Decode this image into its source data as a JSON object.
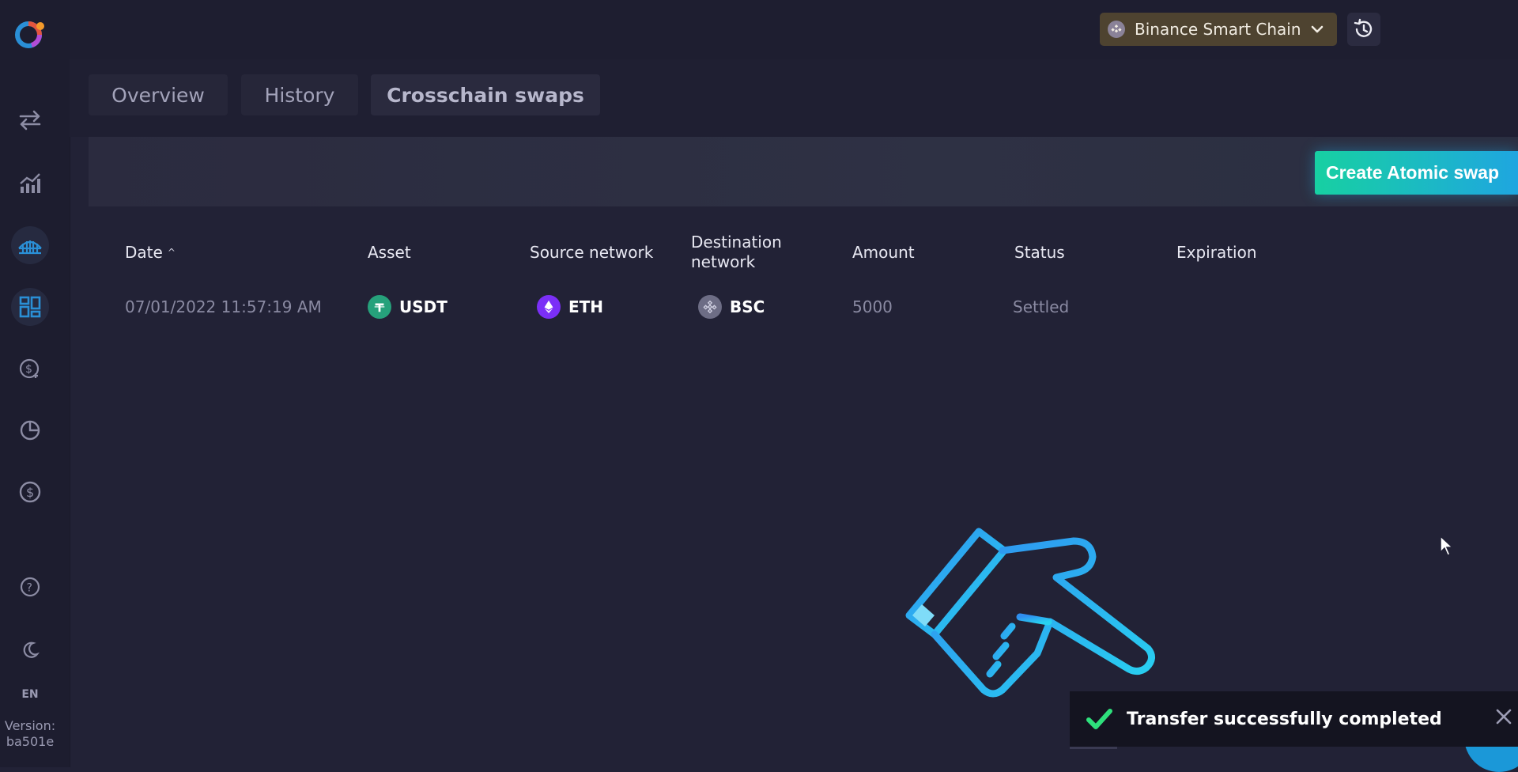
{
  "header": {
    "network": "Binance Smart Chain",
    "icons": {
      "network": "bnb-icon",
      "dropdown": "chevron-down-icon",
      "history": "history-clock-icon"
    }
  },
  "tabs": [
    {
      "label": "Overview",
      "active": false
    },
    {
      "label": "History",
      "active": false
    },
    {
      "label": "Crosschain swaps",
      "active": true
    }
  ],
  "actions": {
    "create_label": "Create Atomic swap"
  },
  "table": {
    "columns": [
      "Date",
      "Asset",
      "Source network",
      "Destination network",
      "Amount",
      "Status",
      "Expiration"
    ],
    "sort_indicator": "^",
    "rows": [
      {
        "date": "07/01/2022 11:57:19 AM",
        "asset": "USDT",
        "source_network": "ETH",
        "destination_network": "BSC",
        "amount": "5000",
        "status": "Settled",
        "expiration": ""
      }
    ]
  },
  "sidebar": {
    "items": [
      "swap-arrows-icon",
      "chart-growth-icon",
      "bridge-icon",
      "dashboard-grid-icon",
      "coin-plus-icon",
      "pie-chart-icon",
      "dollar-circle-icon",
      "help-icon",
      "moon-icon"
    ],
    "active_item": "dashboard-grid-icon",
    "language": "EN",
    "version_label": "Version:",
    "version_value": "ba501e"
  },
  "toast": {
    "message": "Transfer successfully completed",
    "status": "success"
  },
  "colors": {
    "accent_blue": "#2a8fd6",
    "button_gradient_start": "#17d0a2",
    "button_gradient_end": "#1fa6e0",
    "usdt": "#26a17b",
    "eth": "#7b2ff7",
    "bsc_gray": "#6d6d85",
    "success_green": "#2ee07c"
  }
}
